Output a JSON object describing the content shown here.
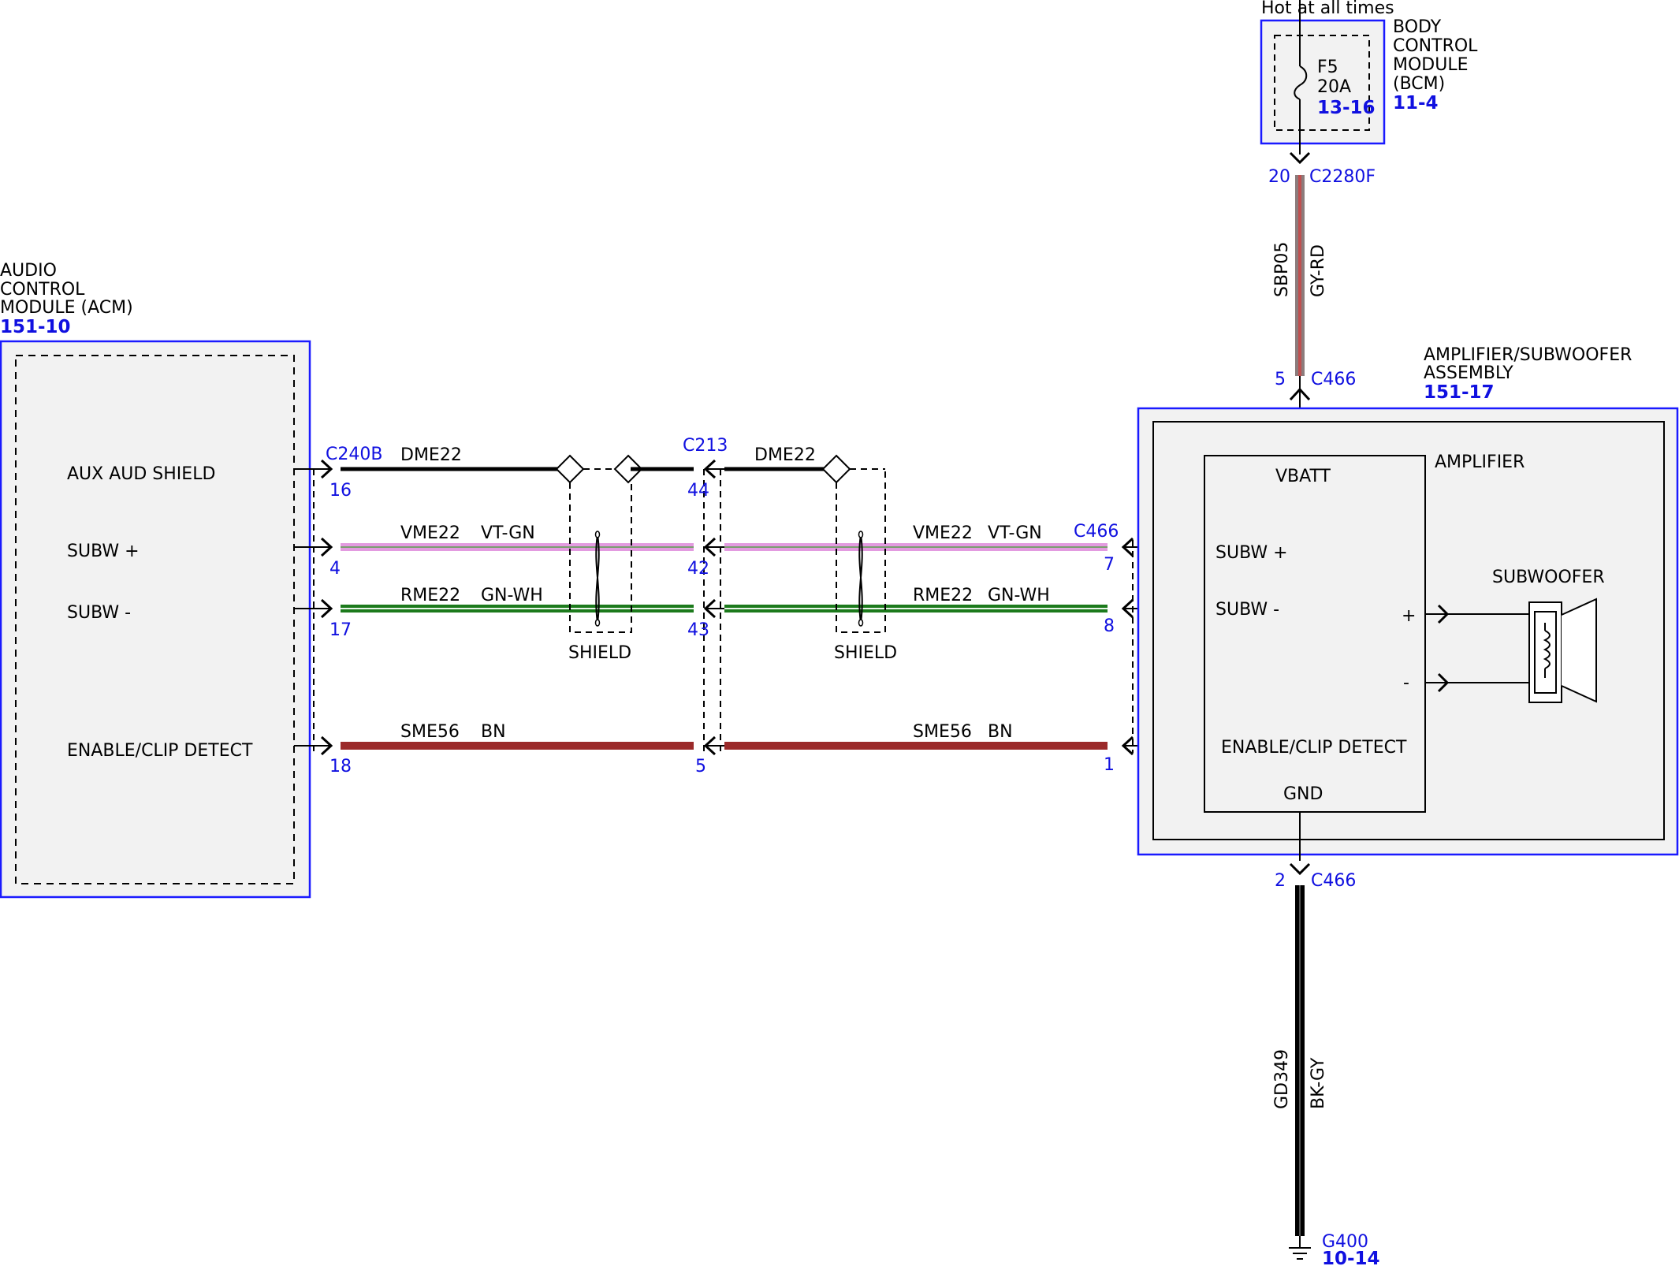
{
  "colors": {
    "module_border": "#1a1aff",
    "module_fill": "#f2f2f2",
    "connector_text": "#1010e0",
    "wire_vt_gn_base": "#e39be0",
    "wire_vt_gn_stripe": "#7b9e70",
    "wire_gn_wh_base": "#1c7a1c",
    "wire_gn_wh_stripe": "#e8f5e8",
    "wire_bn": "#9b2a2a",
    "wire_gy_rd": "#8c7c7c",
    "wire_gy_rd_stripe": "#c05050",
    "wire_bk_gy": "#000000",
    "wire_dme": "#000000"
  },
  "bcm": {
    "hot_label": "Hot at all times",
    "title_lines": [
      "BODY",
      "CONTROL",
      "MODULE",
      "(BCM)"
    ],
    "ref": "11-4",
    "fuse_name": "F5",
    "fuse_rating": "20A",
    "fuse_ref": "13-16"
  },
  "acm": {
    "title_lines": [
      "AUDIO",
      "CONTROL",
      "MODULE (ACM)"
    ],
    "ref": "151-10",
    "pins": {
      "aux": "AUX AUD SHIELD",
      "subw_plus": "SUBW +",
      "subw_minus": "SUBW -",
      "enable": "ENABLE/CLIP DETECT"
    }
  },
  "amp": {
    "title_lines": [
      "AMPLIFIER/SUBWOOFER",
      "ASSEMBLY"
    ],
    "ref": "151-17",
    "inner_label": "AMPLIFIER",
    "vbatt": "VBATT",
    "subw_plus": "SUBW +",
    "subw_minus": "SUBW -",
    "enable": "ENABLE/CLIP DETECT",
    "gnd": "GND",
    "subwoofer": "SUBWOOFER",
    "plus": "+",
    "minus": "-"
  },
  "connectors": {
    "c240b": "C240B",
    "c213": "C213",
    "c466_right": "C466",
    "c2280f": "C2280F",
    "c466_top": "C466",
    "c466_bottom": "C466"
  },
  "pins": {
    "acm_16": "16",
    "acm_4": "4",
    "acm_17": "17",
    "acm_18": "18",
    "c213_44": "44",
    "c213_42": "42",
    "c213_43": "43",
    "c213_5": "5",
    "amp_7": "7",
    "amp_8": "8",
    "amp_1": "1",
    "c2280f_20": "20",
    "c466_5": "5",
    "c466_2": "2"
  },
  "wires": {
    "dme22": "DME22",
    "vme22": "VME22",
    "vt_gn": "VT-GN",
    "rme22": "RME22",
    "gn_wh": "GN-WH",
    "sme56": "SME56",
    "bn": "BN",
    "sbp05": "SBP05",
    "gy_rd": "GY-RD",
    "gd349": "GD349",
    "bk_gy": "BK-GY"
  },
  "shield_label": "SHIELD",
  "ground": {
    "name": "G400",
    "ref": "10-14"
  }
}
